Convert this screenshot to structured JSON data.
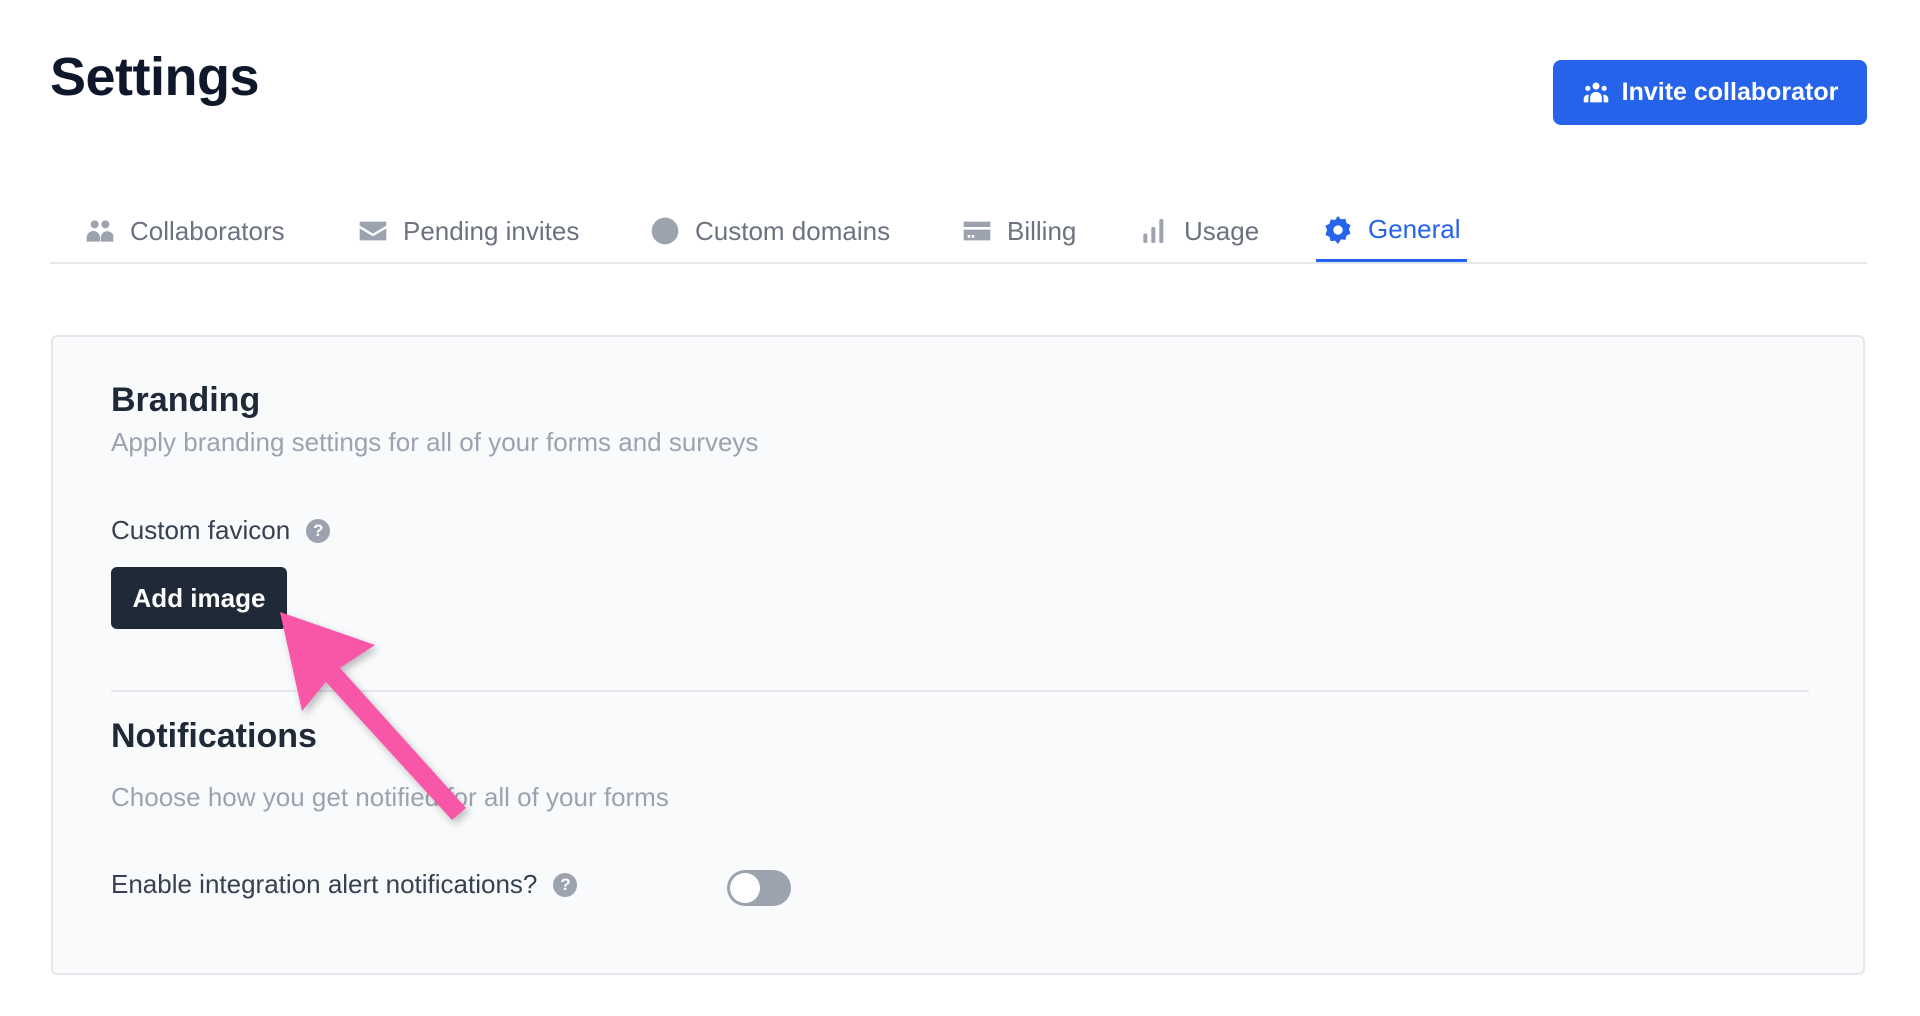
{
  "page": {
    "title": "Settings",
    "invite_button_label": "Invite collaborator"
  },
  "tabs": [
    {
      "label": "Collaborators",
      "icon": "users-icon"
    },
    {
      "label": "Pending invites",
      "icon": "envelope-icon"
    },
    {
      "label": "Custom domains",
      "icon": "globe-icon"
    },
    {
      "label": "Billing",
      "icon": "credit-card-icon"
    },
    {
      "label": "Usage",
      "icon": "bar-chart-icon"
    },
    {
      "label": "General",
      "icon": "gear-icon",
      "active": true
    }
  ],
  "branding": {
    "title": "Branding",
    "description": "Apply branding settings for all of your forms and surveys",
    "favicon_label": "Custom favicon",
    "help_glyph": "?",
    "add_image_label": "Add image"
  },
  "notifications": {
    "title": "Notifications",
    "description": "Choose how you get notified for all of your forms",
    "integration_alert_label": "Enable integration alert notifications?",
    "help_glyph": "?",
    "integration_alert_enabled": false
  },
  "colors": {
    "accent": "#2563eb",
    "annotation_arrow": "#f857a6",
    "dark_button": "#1f2937"
  }
}
